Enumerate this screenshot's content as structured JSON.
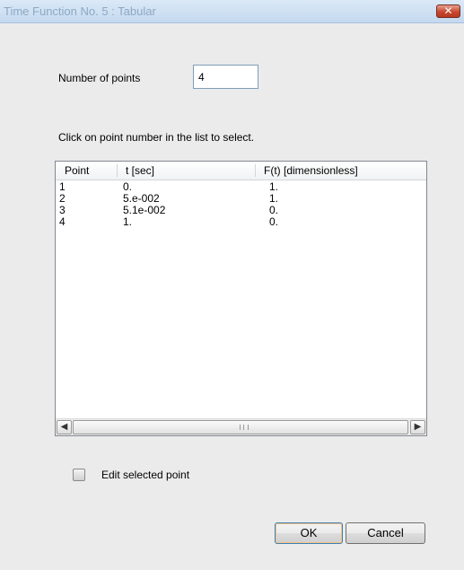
{
  "window": {
    "title": "Time Function No. 5 : Tabular",
    "close_glyph": "✕"
  },
  "form": {
    "number_of_points_label": "Number of points",
    "number_of_points_value": "4",
    "instruction": "Click on point number in the list to select."
  },
  "table": {
    "columns": [
      "Point",
      "t  [sec]",
      "F(t)  [dimensionless]"
    ],
    "rows": [
      [
        "1",
        "0.",
        "1."
      ],
      [
        "2",
        "5.e-002",
        "1."
      ],
      [
        "3",
        "5.1e-002",
        "0."
      ],
      [
        "4",
        "1.",
        "0."
      ]
    ]
  },
  "scrollbar": {
    "left_arrow": "◀",
    "right_arrow": "▶"
  },
  "edit_checkbox": {
    "label": "Edit selected point",
    "checked": false
  },
  "buttons": {
    "ok": "OK",
    "cancel": "Cancel"
  }
}
